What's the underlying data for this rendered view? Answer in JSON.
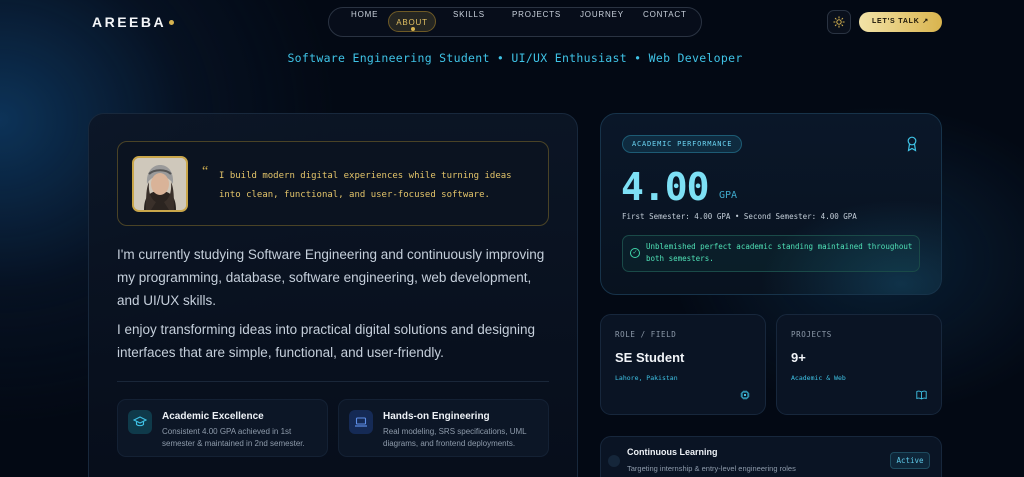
{
  "brand": {
    "name": "AREEBA"
  },
  "nav": {
    "items": [
      {
        "label": "HOME"
      },
      {
        "label": "ABOUT",
        "active": true
      },
      {
        "label": "SKILLS"
      },
      {
        "label": "PROJECTS"
      },
      {
        "label": "JOURNEY"
      },
      {
        "label": "CONTACT"
      }
    ],
    "theme_icon": "sun-icon",
    "cta_label": "LET'S TALK ↗"
  },
  "tagline": "Software Engineering Student • UI/UX Enthusiast • Web Developer",
  "about": {
    "quote": "I build modern digital experiences while turning ideas into clean, functional, and user-focused software.",
    "paragraph1": "I'm currently studying Software Engineering and continuously improving my programming, database, software engineering, web development, and UI/UX skills.",
    "paragraph2": "I enjoy transforming ideas into practical digital solutions and designing interfaces that are simple, functional, and user-friendly.",
    "features": [
      {
        "icon": "graduation-cap-icon",
        "title": "Academic Excellence",
        "desc": "Consistent 4.00 GPA achieved in 1st semester & maintained in 2nd semester."
      },
      {
        "icon": "laptop-icon",
        "title": "Hands-on Engineering",
        "desc": "Real modeling, SRS specifications, UML diagrams, and frontend deployments."
      }
    ]
  },
  "academic": {
    "badge": "ACADEMIC PERFORMANCE",
    "gpa": "4.00",
    "gpa_label": "GPA",
    "semesters": "First Semester: 4.00 GPA • Second Semester: 4.00 GPA",
    "standing": "Unblemished perfect academic standing maintained throughout both semesters."
  },
  "stats": [
    {
      "label": "ROLE / FIELD",
      "value": "SE Student",
      "sub": "Lahore, Pakistan",
      "icon": "chip-icon"
    },
    {
      "label": "PROJECTS",
      "value": "9+",
      "sub": "Academic & Web",
      "icon": "book-icon"
    }
  ],
  "learning": {
    "title": "Continuous Learning",
    "desc": "Targeting internship & entry-level engineering roles",
    "status": "Active"
  },
  "colors": {
    "accent_gold": "#d6b350",
    "accent_cyan": "#3fc3e6",
    "success": "#4fe0b6",
    "background": "#030914"
  }
}
